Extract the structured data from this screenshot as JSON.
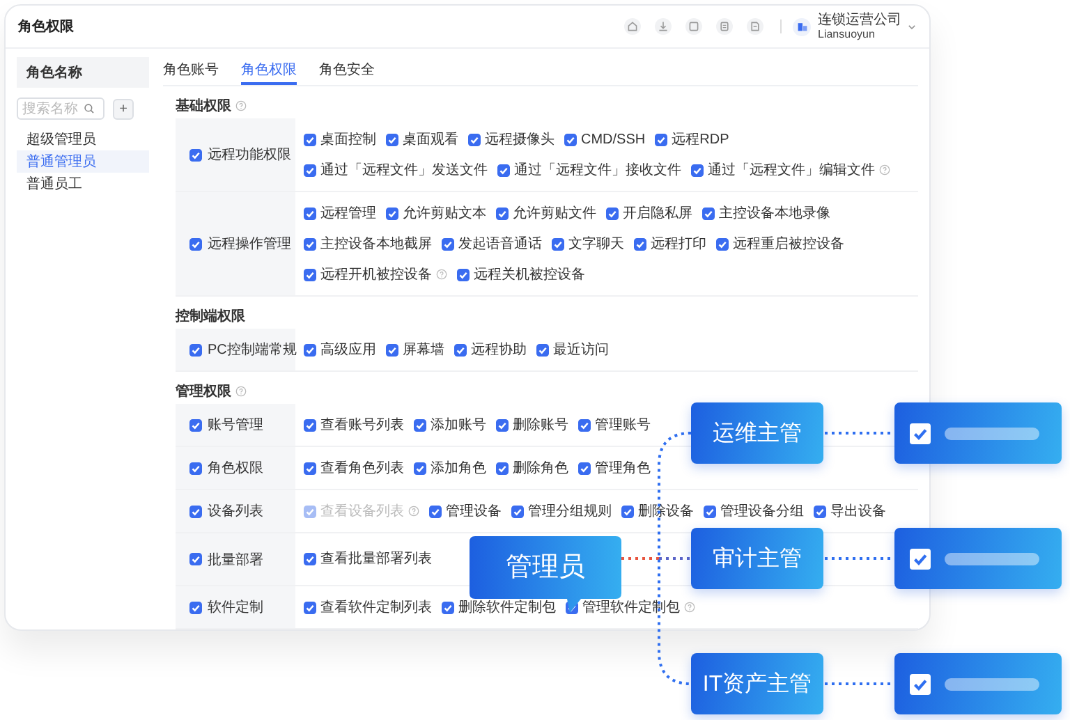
{
  "window": {
    "title": "角色权限"
  },
  "account": {
    "company": "连锁运营公司",
    "subtitle": "Liansuoyun"
  },
  "sidebar": {
    "header": "角色名称",
    "search": {
      "placeholder": "搜索名称"
    },
    "add_button": "+",
    "items": [
      {
        "label": "超级管理员",
        "selected": false
      },
      {
        "label": "普通管理员",
        "selected": true
      },
      {
        "label": "普通员工",
        "selected": false
      }
    ]
  },
  "tabs": [
    {
      "label": "角色账号",
      "selected": false
    },
    {
      "label": "角色权限",
      "selected": true
    },
    {
      "label": "角色安全",
      "selected": false
    }
  ],
  "sections": [
    {
      "title": "基础权限",
      "help": true,
      "groups": [
        {
          "label": "远程功能权限",
          "checked": true,
          "items": [
            {
              "label": "桌面控制",
              "checked": true,
              "disabled": false
            },
            {
              "label": "桌面观看",
              "checked": true,
              "disabled": false
            },
            {
              "label": "远程摄像头",
              "checked": true,
              "disabled": false
            },
            {
              "label": "CMD/SSH",
              "checked": true,
              "disabled": false
            },
            {
              "label": "远程RDP",
              "checked": true,
              "disabled": false
            },
            {
              "label": "通过「远程文件」发送文件",
              "checked": true,
              "disabled": false
            },
            {
              "label": "通过「远程文件」接收文件",
              "checked": true,
              "disabled": false
            },
            {
              "label": "通过「远程文件」编辑文件",
              "checked": true,
              "disabled": false,
              "help": true
            }
          ]
        },
        {
          "label": "远程操作管理",
          "checked": true,
          "items": [
            {
              "label": "远程管理",
              "checked": true,
              "disabled": false
            },
            {
              "label": "允许剪贴文本",
              "checked": true,
              "disabled": false
            },
            {
              "label": "允许剪贴文件",
              "checked": true,
              "disabled": false
            },
            {
              "label": "开启隐私屏",
              "checked": true,
              "disabled": false
            },
            {
              "label": "主控设备本地录像",
              "checked": true,
              "disabled": false
            },
            {
              "label": "主控设备本地截屏",
              "checked": true,
              "disabled": false
            },
            {
              "label": "发起语音通话",
              "checked": true,
              "disabled": false
            },
            {
              "label": "文字聊天",
              "checked": true,
              "disabled": false
            },
            {
              "label": "远程打印",
              "checked": true,
              "disabled": false
            },
            {
              "label": "远程重启被控设备",
              "checked": true,
              "disabled": false
            },
            {
              "label": "远程开机被控设备",
              "checked": true,
              "disabled": false,
              "help": true
            },
            {
              "label": "远程关机被控设备",
              "checked": true,
              "disabled": false
            }
          ]
        }
      ]
    },
    {
      "title": "控制端权限",
      "groups": [
        {
          "label": "PC控制端常规",
          "checked": true,
          "items": [
            {
              "label": "高级应用",
              "checked": true,
              "disabled": false
            },
            {
              "label": "屏幕墙",
              "checked": true,
              "disabled": false
            },
            {
              "label": "远程协助",
              "checked": true,
              "disabled": false
            },
            {
              "label": "最近访问",
              "checked": true,
              "disabled": false
            }
          ]
        }
      ]
    },
    {
      "title": "管理权限",
      "help": true,
      "groups": [
        {
          "label": "账号管理",
          "checked": true,
          "items": [
            {
              "label": "查看账号列表",
              "checked": true,
              "disabled": false
            },
            {
              "label": "添加账号",
              "checked": true,
              "disabled": false
            },
            {
              "label": "删除账号",
              "checked": true,
              "disabled": false
            },
            {
              "label": "管理账号",
              "checked": true,
              "disabled": false
            }
          ]
        },
        {
          "label": "角色权限",
          "checked": true,
          "items": [
            {
              "label": "查看角色列表",
              "checked": true,
              "disabled": false
            },
            {
              "label": "添加角色",
              "checked": true,
              "disabled": false
            },
            {
              "label": "删除角色",
              "checked": true,
              "disabled": false
            },
            {
              "label": "管理角色",
              "checked": true,
              "disabled": false
            }
          ]
        },
        {
          "label": "设备列表",
          "checked": true,
          "items": [
            {
              "label": "查看设备列表",
              "checked": true,
              "disabled": true,
              "help": true
            },
            {
              "label": "管理设备",
              "checked": true,
              "disabled": false
            },
            {
              "label": "管理分组规则",
              "checked": true,
              "disabled": false
            },
            {
              "label": "删除设备",
              "checked": true,
              "disabled": false
            },
            {
              "label": "管理设备分组",
              "checked": true,
              "disabled": false
            },
            {
              "label": "导出设备",
              "checked": true,
              "disabled": false
            }
          ]
        },
        {
          "label": "批量部署",
          "checked": true,
          "items": [
            {
              "label": "查看批量部署列表",
              "checked": true,
              "disabled": false
            }
          ]
        },
        {
          "label": "软件定制",
          "checked": true,
          "items": [
            {
              "label": "查看软件定制列表",
              "checked": true,
              "disabled": false
            },
            {
              "label": "删除软件定制包",
              "checked": true,
              "disabled": false
            },
            {
              "label": "管理软件定制包",
              "checked": true,
              "disabled": false,
              "help": true
            }
          ]
        }
      ]
    }
  ],
  "diagram": {
    "root": "管理员",
    "roles": [
      {
        "label": "运维主管",
        "checked": true
      },
      {
        "label": "审计主管",
        "checked": true
      },
      {
        "label": "IT资产主管",
        "checked": true
      }
    ]
  }
}
